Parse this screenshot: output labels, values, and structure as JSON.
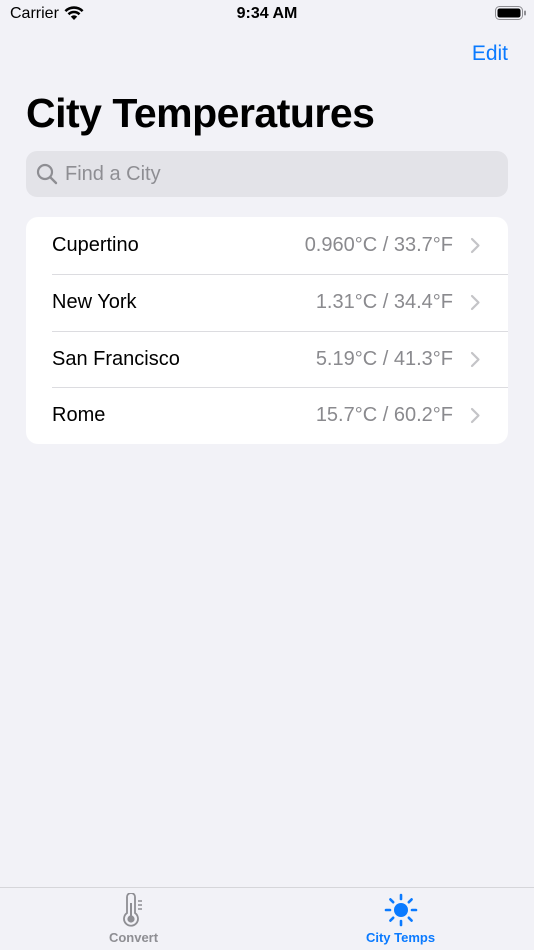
{
  "status_bar": {
    "carrier": "Carrier",
    "time": "9:34 AM"
  },
  "nav": {
    "edit_label": "Edit"
  },
  "page_title": "City Temperatures",
  "search": {
    "placeholder": "Find a City",
    "value": ""
  },
  "cities": [
    {
      "name": "Cupertino",
      "temp": "0.960°C / 33.7°F"
    },
    {
      "name": "New York",
      "temp": "1.31°C / 34.4°F"
    },
    {
      "name": "San Francisco",
      "temp": "5.19°C / 41.3°F"
    },
    {
      "name": "Rome",
      "temp": "15.7°C / 60.2°F"
    }
  ],
  "tabs": [
    {
      "label": "Convert",
      "icon": "thermometer-icon",
      "selected": false
    },
    {
      "label": "City Temps",
      "icon": "sun-icon",
      "selected": true
    }
  ],
  "colors": {
    "accent": "#0a7aff",
    "background": "#f2f2f7",
    "secondary_text": "#8a8a8e"
  }
}
